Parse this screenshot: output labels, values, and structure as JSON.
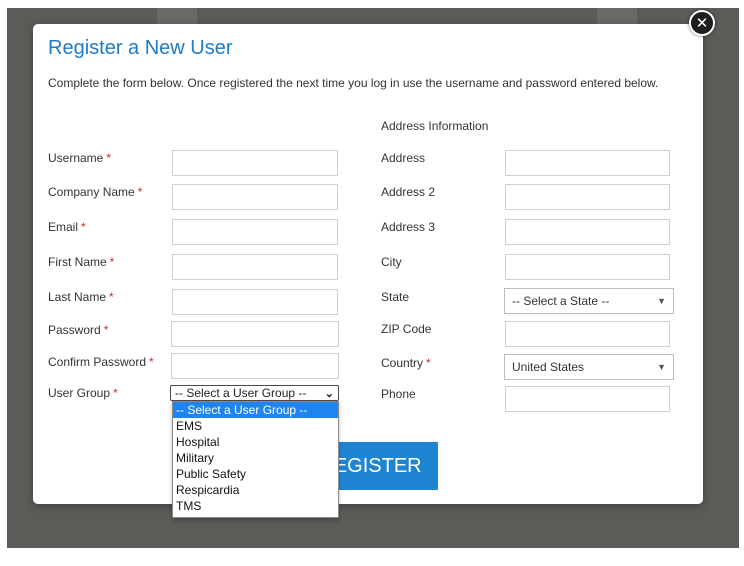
{
  "modal": {
    "title": "Register a New User",
    "intro": "Complete the form below. Once registered the next time you log in use the username and password entered below.",
    "address_section": "Address Information",
    "close_symbol": "✕"
  },
  "left_fields": [
    {
      "label": "Username",
      "required": "*",
      "value": ""
    },
    {
      "label": "Company Name",
      "required": "*",
      "value": ""
    },
    {
      "label": "Email",
      "required": "*",
      "value": ""
    },
    {
      "label": "First Name",
      "required": "*",
      "value": ""
    },
    {
      "label": "Last Name",
      "required": "*",
      "value": ""
    },
    {
      "label": "Password",
      "required": "*",
      "value": ""
    },
    {
      "label": "Confirm Password",
      "required": "*",
      "value": ""
    }
  ],
  "user_group": {
    "label": "User Group",
    "required": "*",
    "selected": "-- Select a User Group --",
    "options": [
      "-- Select a User Group --",
      "EMS",
      "Hospital",
      "Military",
      "Public Safety",
      "Respicardia",
      "TMS"
    ]
  },
  "right_fields": {
    "address": {
      "label": "Address",
      "value": ""
    },
    "address2": {
      "label": "Address 2",
      "value": ""
    },
    "address3": {
      "label": "Address 3",
      "value": ""
    },
    "city": {
      "label": "City",
      "value": ""
    },
    "state": {
      "label": "State",
      "selected": "-- Select a State --"
    },
    "zip": {
      "label": "ZIP Code",
      "value": ""
    },
    "country": {
      "label": "Country",
      "required": "*",
      "selected": "United States"
    },
    "phone": {
      "label": "Phone",
      "value": ""
    }
  },
  "register_button": "REGISTER",
  "colors": {
    "title": "#1e7bc7",
    "button": "#1f84d2",
    "required": "#cc2a2a",
    "highlight": "#1e84f0"
  }
}
